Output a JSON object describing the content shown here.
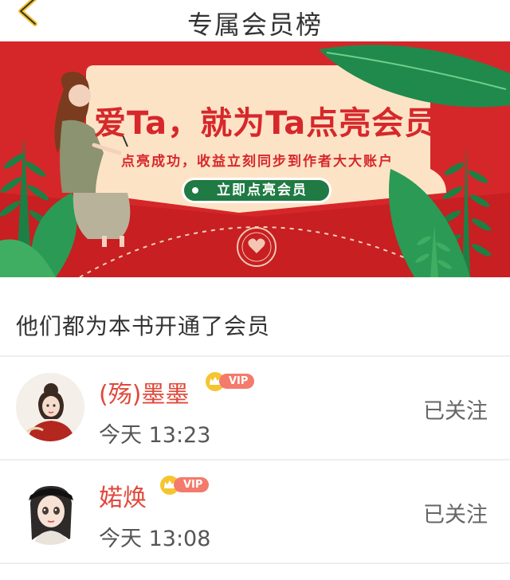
{
  "header": {
    "title": "专属会员榜"
  },
  "banner": {
    "headline": "爱Ta，就为Ta点亮会员",
    "subtitle": "点亮成功，收益立刻同步到作者大大账户",
    "cta_label": "立即点亮会员",
    "colors": {
      "background": "#d52729",
      "card": "#fde3c6",
      "accent_green": "#1f7a44",
      "text": "#d6282b"
    }
  },
  "section": {
    "title": "他们都为本书开通了会员"
  },
  "members": [
    {
      "name": "(殇)墨墨",
      "badge": "VIP",
      "time": "今天 13:23",
      "follow_label": "已关注"
    },
    {
      "name": "婼焕",
      "badge": "VIP",
      "time": "今天 13:08",
      "follow_label": "已关注"
    }
  ]
}
